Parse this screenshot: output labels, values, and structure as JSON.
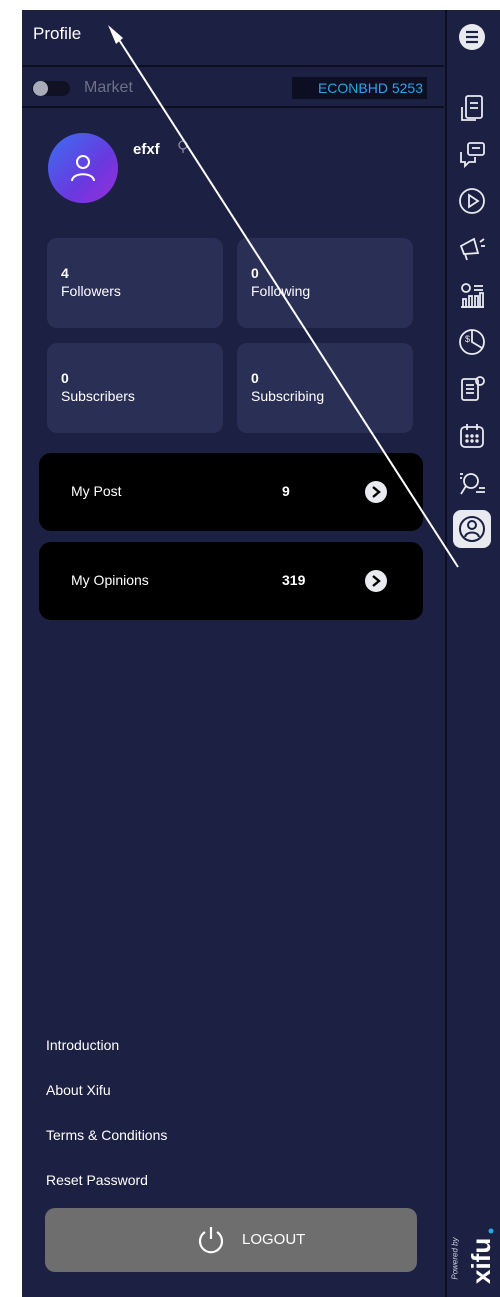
{
  "header": {
    "title": "Profile"
  },
  "market": {
    "label": "Market",
    "badge": "ECONBHD 5253",
    "toggle_on": false
  },
  "user": {
    "name": "efxf"
  },
  "stats": [
    {
      "count": "4",
      "label": "Followers"
    },
    {
      "count": "0",
      "label": "Following"
    },
    {
      "count": "0",
      "label": "Subscribers"
    },
    {
      "count": "0",
      "label": "Subscribing"
    }
  ],
  "cards": [
    {
      "label": "My Post",
      "value": "9"
    },
    {
      "label": "My Opinions",
      "value": "319"
    }
  ],
  "links": [
    "Introduction",
    "About Xifu",
    "Terms & Conditions",
    "Reset Password"
  ],
  "logout": {
    "label": "LOGOUT"
  },
  "footer": {
    "powered_by": "Powered by",
    "brand": "xifu"
  },
  "rail": {
    "icons": [
      "menu-icon",
      "document-icon",
      "chat-icon",
      "play-icon",
      "megaphone-icon",
      "finance-chart-icon",
      "dollar-chart-icon",
      "news-icon",
      "calendar-icon",
      "search-settings-icon",
      "profile-icon"
    ],
    "active": "profile-icon"
  },
  "colors": {
    "panel_bg": "#1c2042",
    "card_bg": "#2a2f55",
    "accent_blue": "#29a6ea",
    "active_rail": "#e9eaf0"
  }
}
